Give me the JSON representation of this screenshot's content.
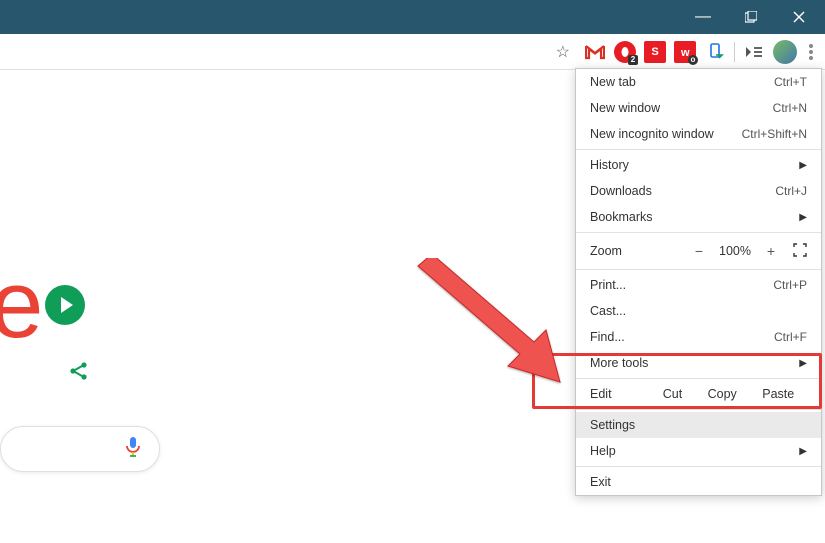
{
  "titlebar": {
    "minimize": "—",
    "maximize": "▢",
    "close": "✕"
  },
  "toolbar": {
    "star": "☆",
    "opera_badge": "2",
    "smule_text": "S",
    "ext4_badge": "o",
    "cast_glyph": "⏵≡"
  },
  "menu": {
    "new_tab": {
      "label": "New tab",
      "shortcut": "Ctrl+T"
    },
    "new_window": {
      "label": "New window",
      "shortcut": "Ctrl+N"
    },
    "new_incognito": {
      "label": "New incognito window",
      "shortcut": "Ctrl+Shift+N"
    },
    "history": {
      "label": "History"
    },
    "downloads": {
      "label": "Downloads",
      "shortcut": "Ctrl+J"
    },
    "bookmarks": {
      "label": "Bookmarks"
    },
    "zoom": {
      "label": "Zoom",
      "minus": "−",
      "value": "100%",
      "plus": "+"
    },
    "print": {
      "label": "Print...",
      "shortcut": "Ctrl+P"
    },
    "cast": {
      "label": "Cast..."
    },
    "find": {
      "label": "Find...",
      "shortcut": "Ctrl+F"
    },
    "more_tools": {
      "label": "More tools"
    },
    "edit": {
      "label": "Edit",
      "cut": "Cut",
      "copy": "Copy",
      "paste": "Paste"
    },
    "settings": {
      "label": "Settings"
    },
    "help": {
      "label": "Help"
    },
    "exit": {
      "label": "Exit"
    }
  },
  "search": {
    "logo_char": "e"
  }
}
